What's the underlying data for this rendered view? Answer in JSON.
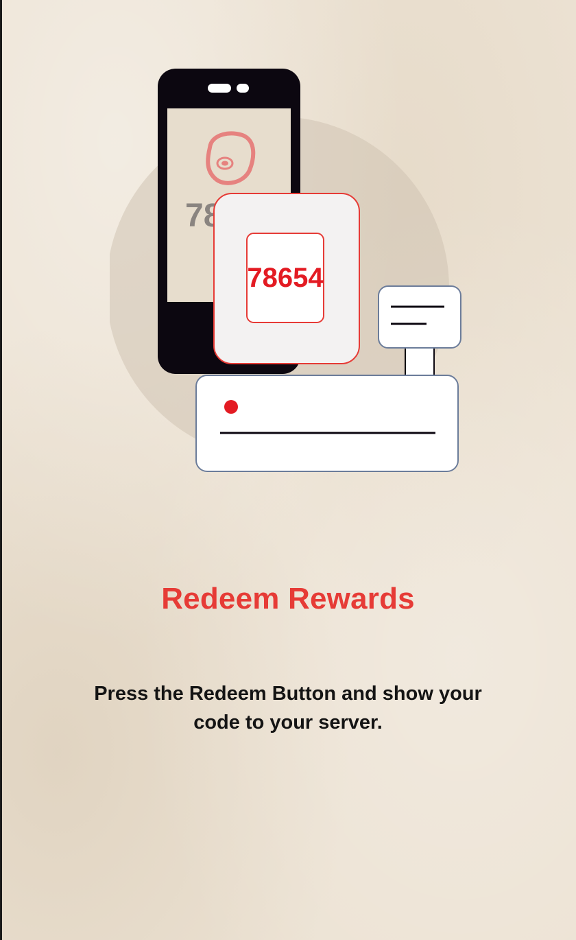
{
  "onboarding": {
    "title": "Redeem Rewards",
    "description": "Press the Redeem Button and show your code to your server."
  },
  "illustration": {
    "phone_partial_code": "78",
    "redeem_code": "78654",
    "icons": [
      "smartphone-icon",
      "steak-icon",
      "register-terminal-icon",
      "receipt-display-icon"
    ]
  },
  "colors": {
    "accent": "#e63b36",
    "background": "#ece2d3",
    "text": "#141414",
    "phone": "#0c0710",
    "register_border": "#6b7c9a"
  }
}
